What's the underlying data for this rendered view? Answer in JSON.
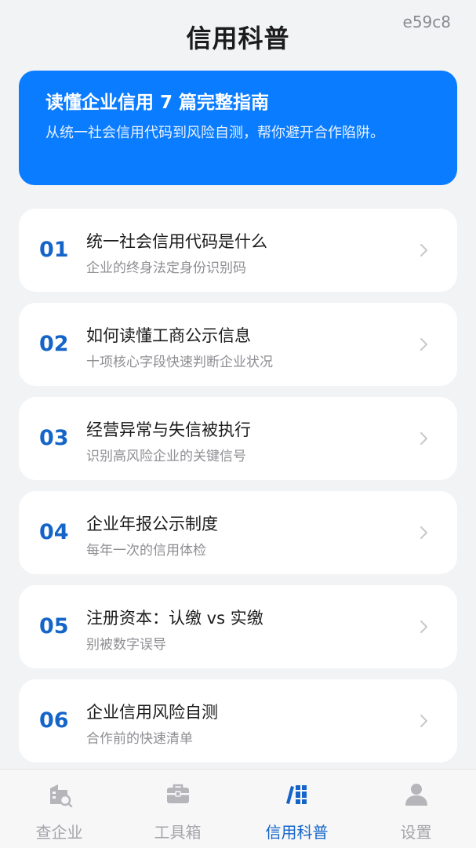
{
  "header": {
    "title": "信用科普",
    "corner_code": "e59c8"
  },
  "hero": {
    "title": "读懂企业信用 7 篇完整指南",
    "subtitle": "从统一社会信用代码到风险自测，帮你避开合作陷阱。"
  },
  "articles": [
    {
      "num": "01",
      "title": "统一社会信用代码是什么",
      "subtitle": "企业的终身法定身份识别码"
    },
    {
      "num": "02",
      "title": "如何读懂工商公示信息",
      "subtitle": "十项核心字段快速判断企业状况"
    },
    {
      "num": "03",
      "title": "经营异常与失信被执行",
      "subtitle": "识别高风险企业的关键信号"
    },
    {
      "num": "04",
      "title": "企业年报公示制度",
      "subtitle": "每年一次的信用体检"
    },
    {
      "num": "05",
      "title": "注册资本：认缴 vs 实缴",
      "subtitle": "别被数字误导"
    },
    {
      "num": "06",
      "title": "企业信用风险自测",
      "subtitle": "合作前的快速清单"
    }
  ],
  "tabbar": {
    "tabs": [
      {
        "label": "查企业",
        "icon": "company-search-icon"
      },
      {
        "label": "工具箱",
        "icon": "toolbox-icon"
      },
      {
        "label": "信用科普",
        "icon": "books-icon"
      },
      {
        "label": "设置",
        "icon": "user-icon"
      }
    ],
    "active_index": 2
  },
  "colors": {
    "accent": "#1565c8",
    "hero_background": "#0a7cff",
    "inactive": "#a5a5aa",
    "page_background": "#f2f3f5"
  }
}
